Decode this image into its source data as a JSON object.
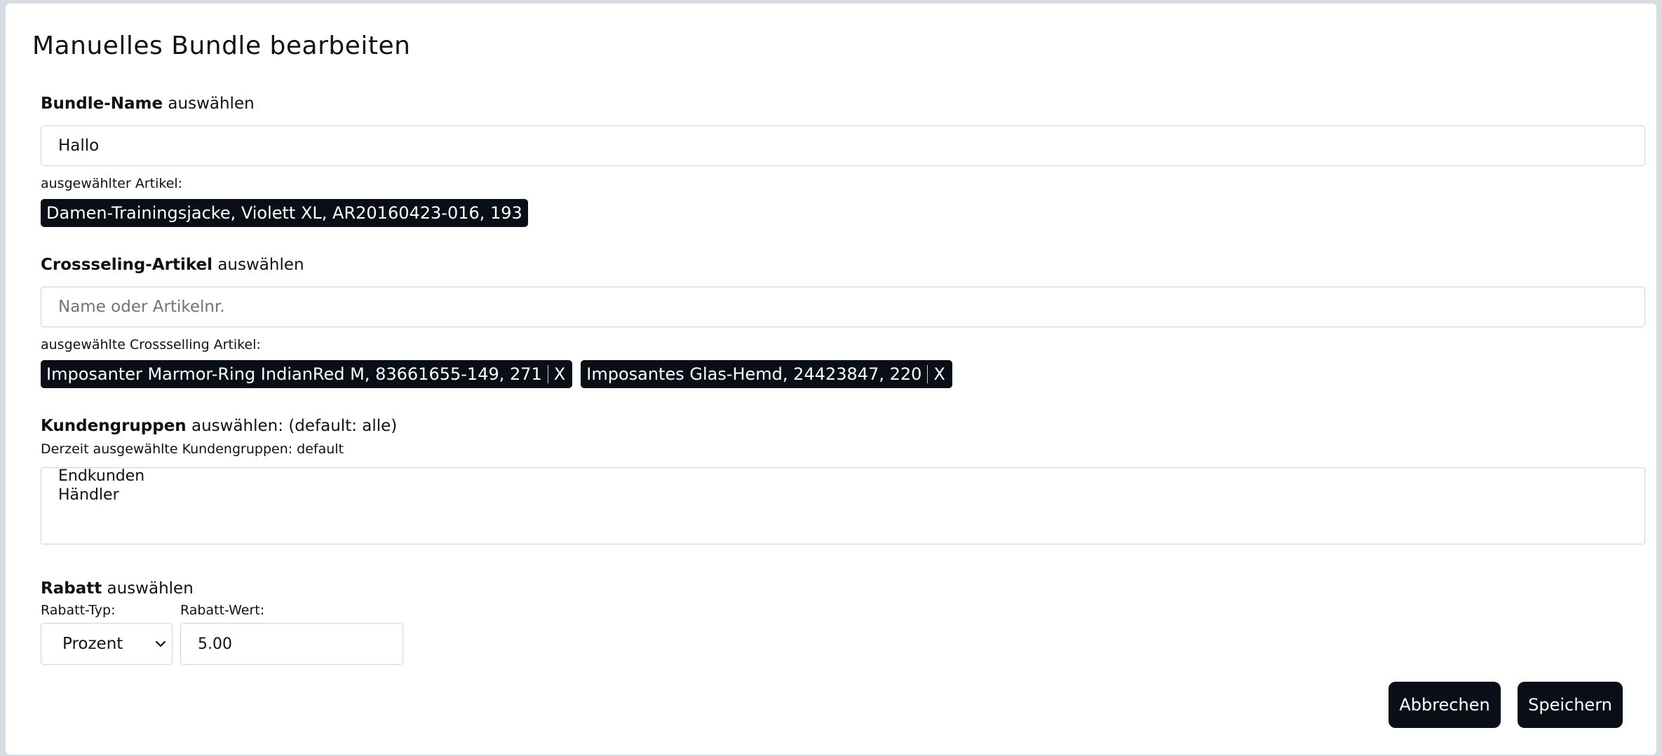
{
  "dialog": {
    "title": "Manuelles Bundle bearbeiten"
  },
  "bundle_name": {
    "label_bold": "Bundle-Name",
    "label_rest": " auswählen",
    "value": "Hallo",
    "selected_label": "ausgewählter Artikel:",
    "selected_item": "Damen-Trainingsjacke, Violett XL, AR20160423-016, 193"
  },
  "crossselling": {
    "label_bold": "Crossseling-Artikel",
    "label_rest": " auswählen",
    "placeholder": "Name oder Artikelnr.",
    "selected_label": "ausgewählte Crossselling Artikel:",
    "items": [
      {
        "label": "Imposanter Marmor-Ring IndianRed M, 83661655-149, 271",
        "remove": "X"
      },
      {
        "label": "Imposantes Glas-Hemd, 24423847, 220",
        "remove": "X"
      }
    ]
  },
  "customer_groups": {
    "label_bold": "Kundengruppen",
    "label_rest": " auswählen: (default: alle)",
    "current": "Derzeit ausgewählte Kundengruppen: default",
    "options": [
      "Endkunden",
      "Händler"
    ]
  },
  "discount": {
    "label_bold": "Rabatt",
    "label_rest": " auswählen",
    "type_label": "Rabatt-Typ:",
    "type_value": "Prozent",
    "value_label": "Rabatt-Wert:",
    "value": "5.00"
  },
  "actions": {
    "cancel": "Abbrechen",
    "save": "Speichern"
  }
}
